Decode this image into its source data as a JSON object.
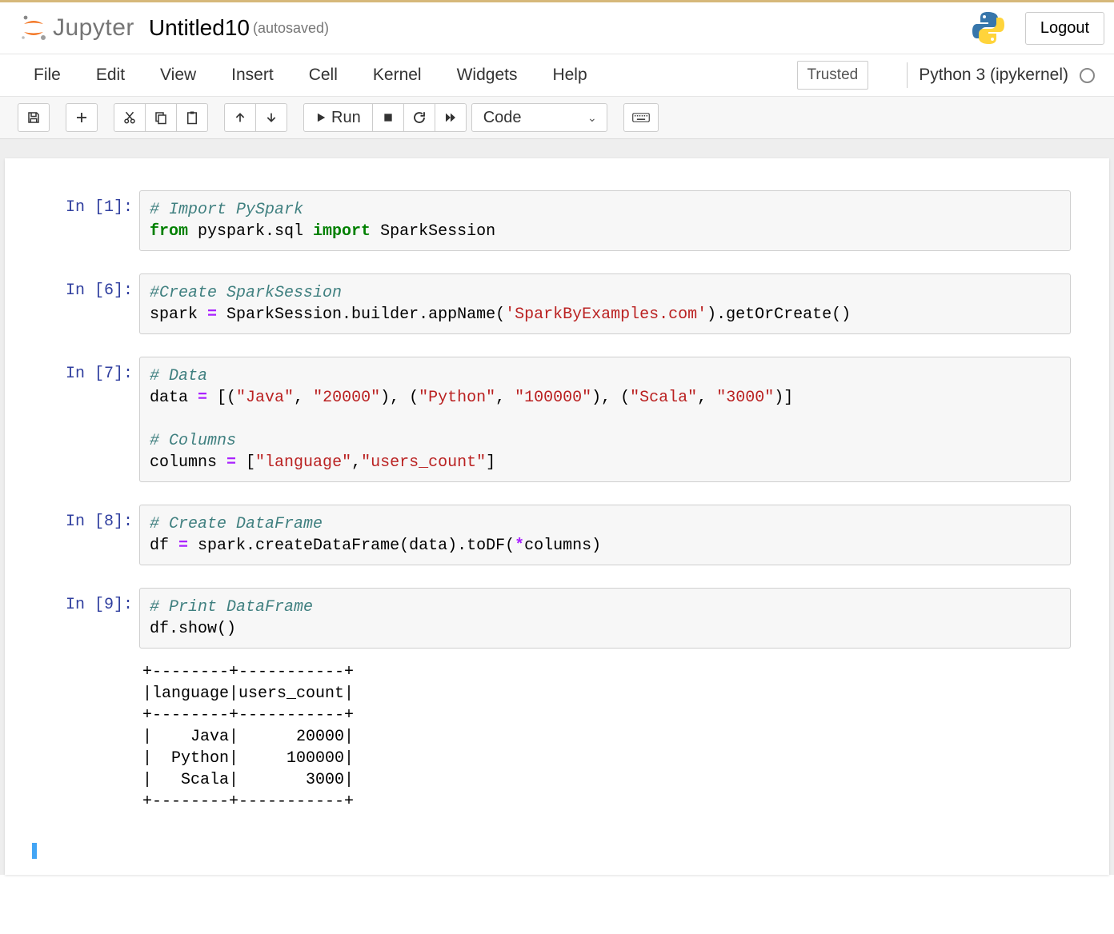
{
  "app": "Jupyter",
  "notebook_title": "Untitled10",
  "autosave_label": "(autosaved)",
  "logout_label": "Logout",
  "menus": [
    "File",
    "Edit",
    "View",
    "Insert",
    "Cell",
    "Kernel",
    "Widgets",
    "Help"
  ],
  "trusted_label": "Trusted",
  "kernel_label": "Python 3 (ipykernel)",
  "toolbar": {
    "run_label": "Run",
    "celltype_selected": "Code"
  },
  "cells": [
    {
      "exec": "In [1]:",
      "code": {
        "lines": [
          {
            "tokens": [
              {
                "c": "cm",
                "t": "# Import PySpark"
              }
            ]
          },
          {
            "tokens": [
              {
                "c": "kw",
                "t": "from"
              },
              {
                "t": " pyspark.sql "
              },
              {
                "c": "kw",
                "t": "import"
              },
              {
                "t": " SparkSession"
              }
            ]
          }
        ]
      }
    },
    {
      "exec": "In [6]:",
      "code": {
        "lines": [
          {
            "tokens": [
              {
                "c": "cm",
                "t": "#Create SparkSession"
              }
            ]
          },
          {
            "tokens": [
              {
                "t": "spark "
              },
              {
                "c": "op",
                "t": "="
              },
              {
                "t": " SparkSession.builder.appName("
              },
              {
                "c": "st",
                "t": "'SparkByExamples.com'"
              },
              {
                "t": ").getOrCreate()"
              }
            ]
          }
        ]
      }
    },
    {
      "exec": "In [7]:",
      "code": {
        "lines": [
          {
            "tokens": [
              {
                "c": "cm",
                "t": "# Data"
              }
            ]
          },
          {
            "tokens": [
              {
                "t": "data "
              },
              {
                "c": "op",
                "t": "="
              },
              {
                "t": " [("
              },
              {
                "c": "st",
                "t": "\"Java\""
              },
              {
                "t": ", "
              },
              {
                "c": "st",
                "t": "\"20000\""
              },
              {
                "t": "), ("
              },
              {
                "c": "st",
                "t": "\"Python\""
              },
              {
                "t": ", "
              },
              {
                "c": "st",
                "t": "\"100000\""
              },
              {
                "t": "), ("
              },
              {
                "c": "st",
                "t": "\"Scala\""
              },
              {
                "t": ", "
              },
              {
                "c": "st",
                "t": "\"3000\""
              },
              {
                "t": ")]"
              }
            ]
          },
          {
            "tokens": [
              {
                "t": ""
              }
            ]
          },
          {
            "tokens": [
              {
                "c": "cm",
                "t": "# Columns"
              }
            ]
          },
          {
            "tokens": [
              {
                "t": "columns "
              },
              {
                "c": "op",
                "t": "="
              },
              {
                "t": " ["
              },
              {
                "c": "st",
                "t": "\"language\""
              },
              {
                "t": ","
              },
              {
                "c": "st",
                "t": "\"users_count\""
              },
              {
                "t": "]"
              }
            ]
          }
        ]
      }
    },
    {
      "exec": "In [8]:",
      "code": {
        "lines": [
          {
            "tokens": [
              {
                "c": "cm",
                "t": "# Create DataFrame"
              }
            ]
          },
          {
            "tokens": [
              {
                "t": "df "
              },
              {
                "c": "op",
                "t": "="
              },
              {
                "t": " spark.createDataFrame(data).toDF("
              },
              {
                "c": "op",
                "t": "*"
              },
              {
                "t": "columns)"
              }
            ]
          }
        ]
      }
    },
    {
      "exec": "In [9]:",
      "code": {
        "lines": [
          {
            "tokens": [
              {
                "c": "cm",
                "t": "# Print DataFrame"
              }
            ]
          },
          {
            "tokens": [
              {
                "t": "df.show()"
              }
            ]
          }
        ]
      },
      "output": "+--------+-----------+\n|language|users_count|\n+--------+-----------+\n|    Java|      20000|\n|  Python|     100000|\n|   Scala|       3000|\n+--------+-----------+"
    }
  ]
}
